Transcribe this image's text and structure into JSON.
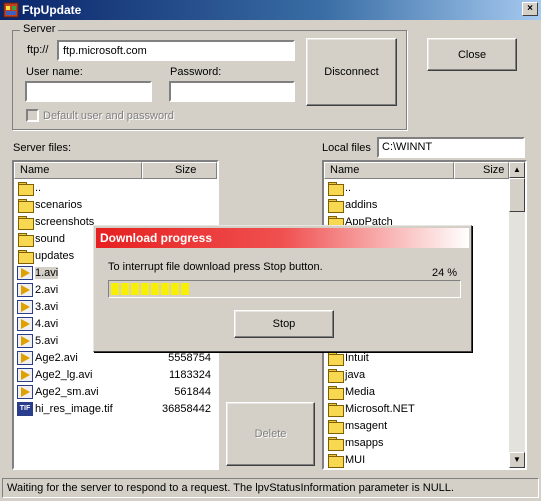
{
  "window": {
    "title": "FtpUpdate",
    "close_glyph": "×"
  },
  "server_group": {
    "label": "Server",
    "ftp_prefix": "ftp://",
    "host": "ftp.microsoft.com",
    "username_label": "User name:",
    "username": "",
    "password_label": "Password:",
    "password": "",
    "default_label": "Default user and password",
    "default_checked": false
  },
  "buttons": {
    "disconnect": "Disconnect",
    "close": "Close",
    "delete": "Delete",
    "stop": "Stop"
  },
  "server_files": {
    "label": "Server files:",
    "col_name": "Name",
    "col_size": "Size",
    "rows": [
      {
        "name": "..",
        "size": "",
        "type": "folder"
      },
      {
        "name": "scenarios",
        "size": "",
        "type": "folder"
      },
      {
        "name": "screenshots",
        "size": "",
        "type": "folder"
      },
      {
        "name": "sound",
        "size": "",
        "type": "folder"
      },
      {
        "name": "updates",
        "size": "",
        "type": "folder"
      },
      {
        "name": "1.avi",
        "size": "",
        "type": "avi",
        "selected": true
      },
      {
        "name": "2.avi",
        "size": "",
        "type": "avi"
      },
      {
        "name": "3.avi",
        "size": "",
        "type": "avi"
      },
      {
        "name": "4.avi",
        "size": "",
        "type": "avi"
      },
      {
        "name": "5.avi",
        "size": "",
        "type": "avi"
      },
      {
        "name": "Age2.avi",
        "size": "5558754",
        "type": "avi"
      },
      {
        "name": "Age2_lg.avi",
        "size": "1183324",
        "type": "avi"
      },
      {
        "name": "Age2_sm.avi",
        "size": "561844",
        "type": "avi"
      },
      {
        "name": "hi_res_image.tif",
        "size": "36858442",
        "type": "tif"
      }
    ]
  },
  "local_files": {
    "label": "Local files",
    "path": "C:\\WINNT",
    "col_name": "Name",
    "col_size": "Size",
    "rows": [
      {
        "name": "..",
        "type": "folder"
      },
      {
        "name": "addins",
        "type": "folder"
      },
      {
        "name": "AppPatch",
        "type": "folder"
      },
      {
        "name": "",
        "type": "hidden"
      },
      {
        "name": "",
        "type": "hidden"
      },
      {
        "name": "",
        "type": "hidden"
      },
      {
        "name": "",
        "type": "hidden"
      },
      {
        "name": "",
        "type": "hidden"
      },
      {
        "name": "",
        "type": "hidden"
      },
      {
        "name": "",
        "type": "hidden"
      },
      {
        "name": "Intuit",
        "type": "folder"
      },
      {
        "name": "java",
        "type": "folder"
      },
      {
        "name": "Media",
        "type": "folder"
      },
      {
        "name": "Microsoft.NET",
        "type": "folder"
      },
      {
        "name": "msagent",
        "type": "folder"
      },
      {
        "name": "msapps",
        "type": "folder"
      },
      {
        "name": "MUI",
        "type": "folder"
      }
    ]
  },
  "dialog": {
    "title": "Download progress",
    "message": "To interrupt file download press Stop button.",
    "percent_text": "24 %",
    "progress_fraction": 0.24
  },
  "status": "Waiting for the server to respond to a request. The lpvStatusInformation parameter is NULL.",
  "icons": {
    "app": "ftpupdate-app-icon",
    "folder": "folder-icon",
    "avi": "avi-file-icon",
    "tif": "tif-file-icon",
    "tif_glyph": "TIF",
    "scroll_up": "▲",
    "scroll_down": "▼"
  }
}
